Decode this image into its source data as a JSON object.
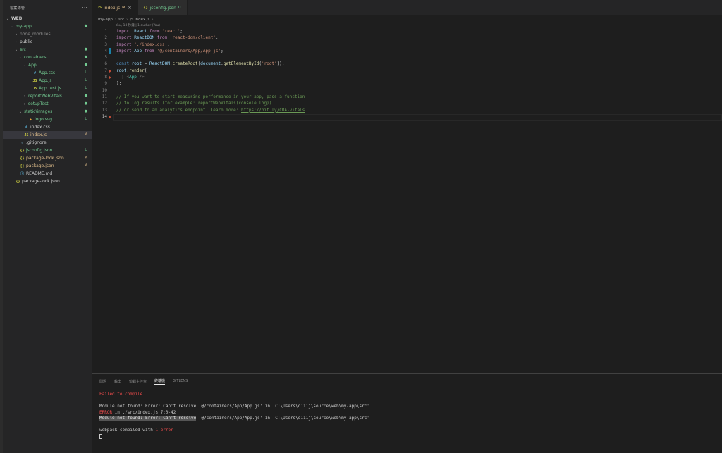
{
  "sidebar": {
    "title": "檔案總管",
    "more": "···",
    "items": [
      {
        "label": "WEB",
        "chev": "⌄",
        "depth": 0,
        "color": "c-def",
        "icon": "",
        "icon_class": "",
        "badge": "",
        "badge_class": "",
        "bold": true
      },
      {
        "label": "my-app",
        "chev": "⌄",
        "depth": 1,
        "color": "c-green",
        "icon": "",
        "icon_class": "",
        "badge": "●",
        "badge_class": "c-green"
      },
      {
        "label": "node_modules",
        "chev": "›",
        "depth": 2,
        "color": "c-dim",
        "icon": "",
        "icon_class": "",
        "badge": "",
        "badge_class": ""
      },
      {
        "label": "public",
        "chev": "›",
        "depth": 2,
        "color": "c-def",
        "icon": "",
        "icon_class": "",
        "badge": "",
        "badge_class": ""
      },
      {
        "label": "src",
        "chev": "⌄",
        "depth": 2,
        "color": "c-green",
        "icon": "",
        "icon_class": "",
        "badge": "●",
        "badge_class": "c-green"
      },
      {
        "label": "containers",
        "chev": "⌄",
        "depth": 3,
        "color": "c-green",
        "icon": "",
        "icon_class": "",
        "badge": "●",
        "badge_class": "c-green"
      },
      {
        "label": "App",
        "chev": "⌄",
        "depth": 4,
        "color": "c-green",
        "icon": "",
        "icon_class": "",
        "badge": "●",
        "badge_class": "c-green"
      },
      {
        "label": "App.css",
        "chev": "",
        "depth": 5,
        "color": "c-green",
        "icon": "#",
        "icon_class": "i-css",
        "badge": "U",
        "badge_class": "c-green"
      },
      {
        "label": "App.js",
        "chev": "",
        "depth": 5,
        "color": "c-green",
        "icon": "JS",
        "icon_class": "i-js",
        "badge": "U",
        "badge_class": "c-green"
      },
      {
        "label": "App.test.js",
        "chev": "",
        "depth": 5,
        "color": "c-green",
        "icon": "JS",
        "icon_class": "i-js",
        "badge": "U",
        "badge_class": "c-green"
      },
      {
        "label": "reportWebVitals",
        "chev": "›",
        "depth": 4,
        "color": "c-green",
        "icon": "",
        "icon_class": "",
        "badge": "●",
        "badge_class": "c-green"
      },
      {
        "label": "setupTest",
        "chev": "›",
        "depth": 4,
        "color": "c-green",
        "icon": "",
        "icon_class": "",
        "badge": "●",
        "badge_class": "c-green"
      },
      {
        "label": "static\\images",
        "chev": "⌄",
        "depth": 3,
        "color": "c-green",
        "icon": "",
        "icon_class": "",
        "badge": "●",
        "badge_class": "c-green"
      },
      {
        "label": "logo.svg",
        "chev": "",
        "depth": 4,
        "color": "c-green",
        "icon": "◈",
        "icon_class": "i-svg",
        "badge": "U",
        "badge_class": "c-green"
      },
      {
        "label": "index.css",
        "chev": "",
        "depth": 3,
        "color": "c-def",
        "icon": "#",
        "icon_class": "i-css",
        "badge": "",
        "badge_class": ""
      },
      {
        "label": "index.js",
        "chev": "",
        "depth": 3,
        "color": "c-mod",
        "icon": "JS",
        "icon_class": "i-js",
        "badge": "M",
        "badge_class": "c-mod",
        "selected": true
      },
      {
        "label": ".gitignore",
        "chev": "",
        "depth": 2,
        "color": "c-def",
        "icon": "◆",
        "icon_class": "i-git",
        "badge": "",
        "badge_class": ""
      },
      {
        "label": "jsconfig.json",
        "chev": "",
        "depth": 2,
        "color": "c-green",
        "icon": "{}",
        "icon_class": "i-json",
        "badge": "U",
        "badge_class": "c-green"
      },
      {
        "label": "package-lock.json",
        "chev": "",
        "depth": 2,
        "color": "c-mod",
        "icon": "{}",
        "icon_class": "i-json",
        "badge": "M",
        "badge_class": "c-mod"
      },
      {
        "label": "package.json",
        "chev": "",
        "depth": 2,
        "color": "c-mod",
        "icon": "{}",
        "icon_class": "i-json",
        "badge": "M",
        "badge_class": "c-mod"
      },
      {
        "label": "README.md",
        "chev": "",
        "depth": 2,
        "color": "c-def",
        "icon": "ⓘ",
        "icon_class": "i-md",
        "badge": "",
        "badge_class": ""
      },
      {
        "label": "package-lock.json",
        "chev": "",
        "depth": 1,
        "color": "c-def",
        "icon": "{}",
        "icon_class": "i-json",
        "badge": "",
        "badge_class": ""
      }
    ]
  },
  "tabs": [
    {
      "icon": "JS",
      "label": "index.js",
      "state": "M",
      "close": "✕",
      "active": true
    },
    {
      "icon": "{}",
      "label": "jsconfig.json",
      "state": "U",
      "close": "",
      "active": false
    }
  ],
  "breadcrumb": [
    "my-app",
    "src",
    "JS index.js",
    "..."
  ],
  "blame": "You, 18 秒鐘 | 1 author (You)",
  "code_lines": [
    {
      "n": "1",
      "g": "",
      "t": [
        [
          "kw",
          "import "
        ],
        [
          "var",
          "React"
        ],
        [
          "kw",
          " from "
        ],
        [
          "str",
          "'react'"
        ],
        [
          "pun",
          ";"
        ]
      ]
    },
    {
      "n": "2",
      "g": "",
      "t": [
        [
          "kw",
          "import "
        ],
        [
          "var",
          "ReactDOM"
        ],
        [
          "kw",
          " from "
        ],
        [
          "str",
          "'react-dom/client'"
        ],
        [
          "pun",
          ";"
        ]
      ]
    },
    {
      "n": "3",
      "g": "",
      "t": [
        [
          "kw",
          "import "
        ],
        [
          "str",
          "'./index.css'"
        ],
        [
          "pun",
          ";"
        ]
      ]
    },
    {
      "n": "4",
      "g": "mod",
      "t": [
        [
          "kw",
          "import "
        ],
        [
          "var",
          "App"
        ],
        [
          "kw",
          " from "
        ],
        [
          "str",
          "'@/containers/App/App.js'"
        ],
        [
          "pun",
          ";"
        ]
      ]
    },
    {
      "n": "5",
      "g": "",
      "t": []
    },
    {
      "n": "6",
      "g": "",
      "t": [
        [
          "kb",
          "const "
        ],
        [
          "var",
          "root"
        ],
        [
          "pun",
          " = "
        ],
        [
          "var",
          "ReactDOM"
        ],
        [
          "pun",
          "."
        ],
        [
          "fn",
          "createRoot"
        ],
        [
          "pun",
          "("
        ],
        [
          "var",
          "document"
        ],
        [
          "pun",
          "."
        ],
        [
          "fn",
          "getElementById"
        ],
        [
          "pun",
          "("
        ],
        [
          "str",
          "'root'"
        ],
        [
          "pun",
          "));"
        ]
      ]
    },
    {
      "n": "7",
      "g": "del",
      "t": [
        [
          "var",
          "root"
        ],
        [
          "pun",
          "."
        ],
        [
          "fn",
          "render"
        ],
        [
          "pun",
          "("
        ]
      ]
    },
    {
      "n": "8",
      "g": "del",
      "t": [
        [
          "br",
          "  ¦ "
        ],
        [
          "br",
          "<"
        ],
        [
          "tag",
          "App"
        ],
        [
          "br",
          " />"
        ]
      ]
    },
    {
      "n": "9",
      "g": "",
      "t": [
        [
          "pun",
          ");"
        ]
      ]
    },
    {
      "n": "10",
      "g": "",
      "t": []
    },
    {
      "n": "11",
      "g": "",
      "t": [
        [
          "com",
          "// If you want to start measuring performance in your app, pass a function"
        ]
      ]
    },
    {
      "n": "12",
      "g": "",
      "t": [
        [
          "com",
          "// to log results (for example: reportWebVitals(console.log))"
        ]
      ]
    },
    {
      "n": "13",
      "g": "",
      "t": [
        [
          "com",
          "// or send to an analytics endpoint. Learn more: "
        ],
        [
          "link",
          "https://bit.ly/CRA-vitals"
        ]
      ]
    },
    {
      "n": "14",
      "g": "del",
      "t": [],
      "current": true
    }
  ],
  "panel": {
    "tabs": [
      "問題",
      "輸出",
      "偵錯主控台",
      "終端機",
      "GITLENS"
    ],
    "active_tab": "終端機",
    "terminal": [
      [
        [
          "red",
          "Failed to compile."
        ]
      ],
      [],
      [
        [
          "",
          "Module not found: Error: Can't resolve '@/containers/App/App.js' in 'C:\\Users\\q111j\\source\\web\\my-app\\src'"
        ]
      ],
      [
        [
          "red",
          "ERROR"
        ],
        [
          "",
          " in ./src/index.js 7:0-42"
        ]
      ],
      [
        [
          "hl",
          "Module not found: Error: Can't resolve"
        ],
        [
          "",
          " '@/containers/App/App.js' in 'C:\\Users\\q111j\\source\\web\\my-app\\src'"
        ]
      ],
      [],
      [
        [
          "",
          "webpack compiled with "
        ],
        [
          "red",
          "1 error"
        ]
      ]
    ]
  }
}
